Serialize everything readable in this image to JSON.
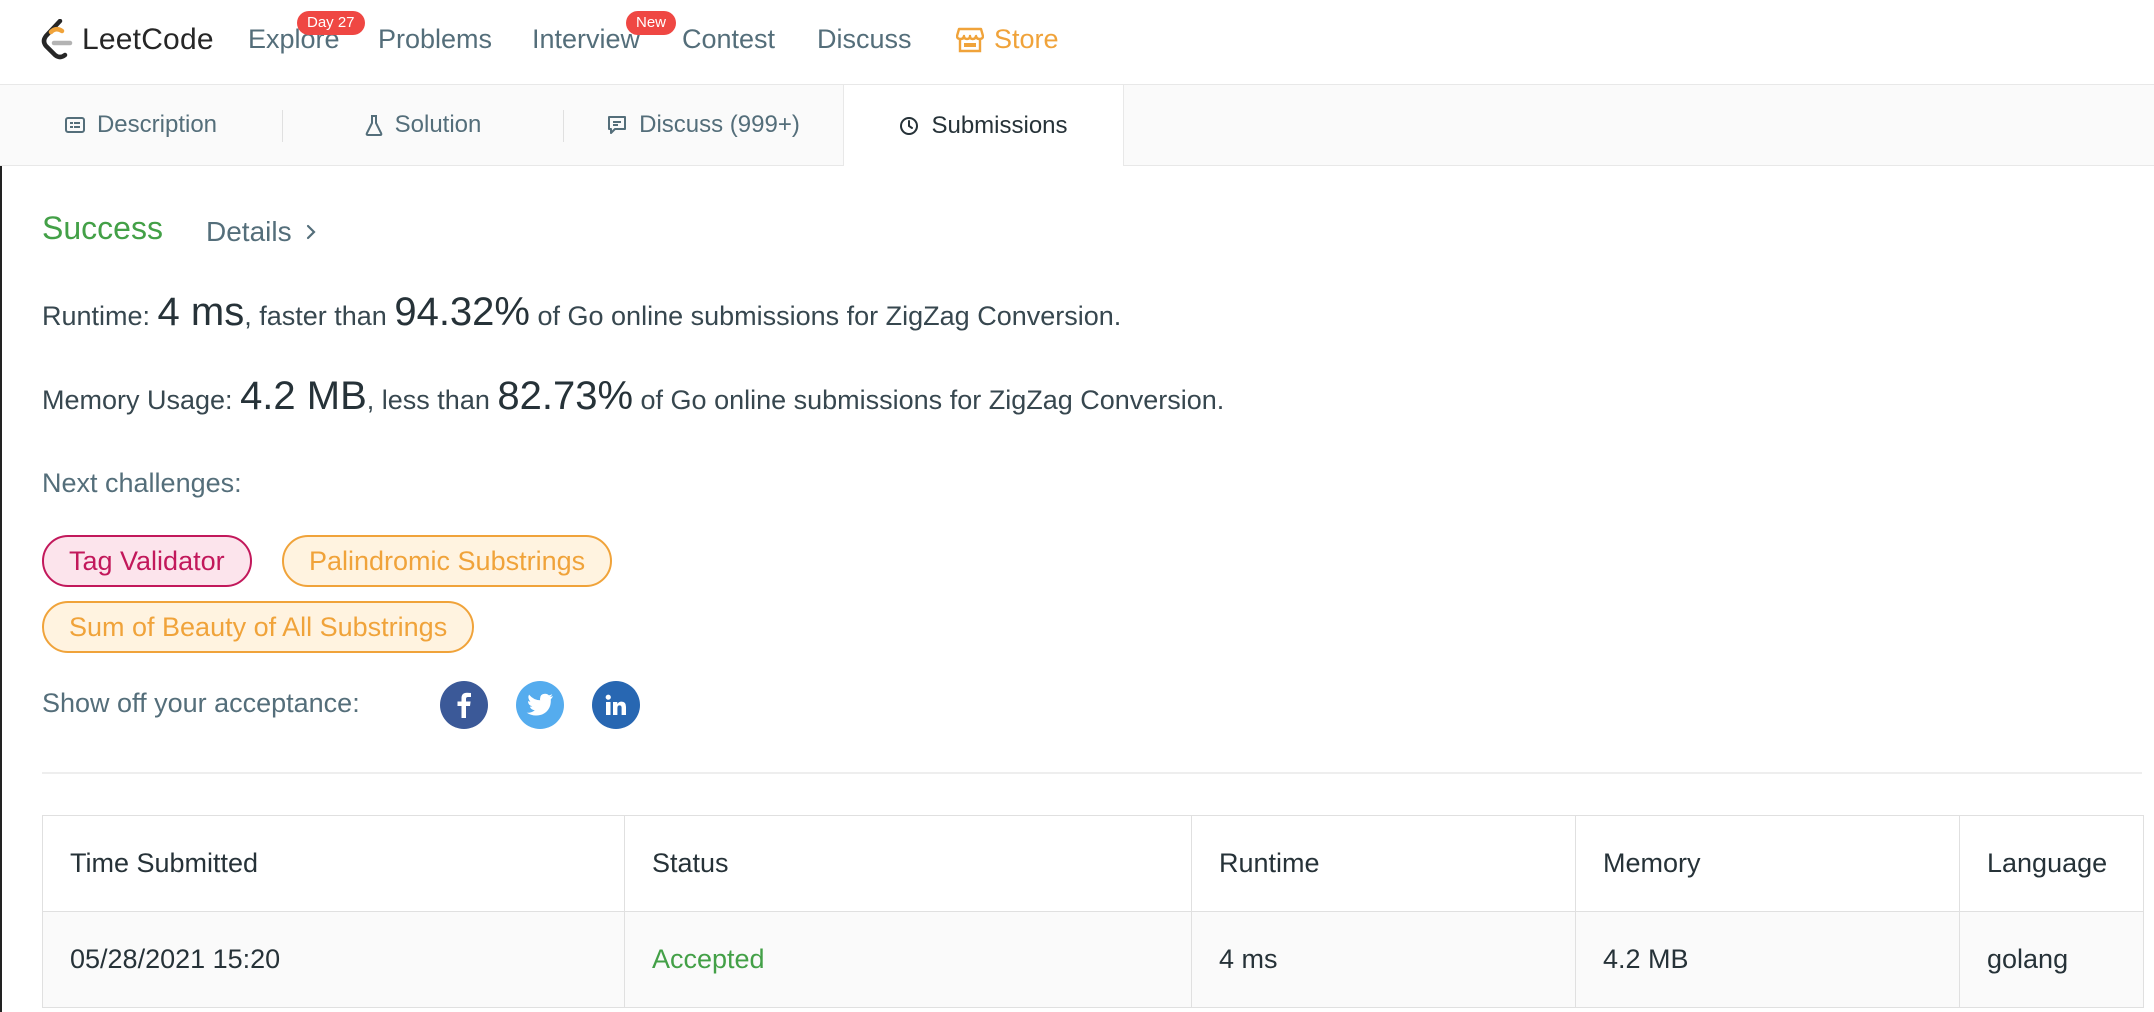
{
  "app": {
    "logo_text": "LeetCode"
  },
  "nav": {
    "items": [
      {
        "label": "Explore",
        "badge": "Day 27"
      },
      {
        "label": "Problems"
      },
      {
        "label": "Interview",
        "badge": "New"
      },
      {
        "label": "Contest"
      },
      {
        "label": "Discuss"
      },
      {
        "label": "Store",
        "icon": "store-icon"
      }
    ]
  },
  "tabs": [
    {
      "label": "Description",
      "icon": "description-icon"
    },
    {
      "label": "Solution",
      "icon": "flask-icon"
    },
    {
      "label": "Discuss (999+)",
      "icon": "comment-icon"
    },
    {
      "label": "Submissions",
      "icon": "clock-icon",
      "active": true
    }
  ],
  "result": {
    "status": "Success",
    "details_label": "Details",
    "runtime": {
      "label": "Runtime: ",
      "value": "4 ms",
      "mid": ", faster than ",
      "percent": "94.32%",
      "tail": " of Go online submissions for ZigZag Conversion."
    },
    "memory": {
      "label": "Memory Usage: ",
      "value": "4.2 MB",
      "mid": ", less than ",
      "percent": "82.73%",
      "tail": " of Go online submissions for ZigZag Conversion."
    },
    "next_label": "Next challenges:",
    "challenges": [
      {
        "label": "Tag Validator",
        "difficulty": "hard"
      },
      {
        "label": "Palindromic Substrings",
        "difficulty": "medium"
      },
      {
        "label": "Sum of Beauty of All Substrings",
        "difficulty": "medium"
      }
    ],
    "share_label": "Show off your acceptance:",
    "share": [
      {
        "icon": "facebook-icon",
        "color": "#3b5998"
      },
      {
        "icon": "twitter-icon",
        "color": "#55acee"
      },
      {
        "icon": "linkedin-icon",
        "color": "#2867b2"
      }
    ]
  },
  "table": {
    "headers": [
      "Time Submitted",
      "Status",
      "Runtime",
      "Memory",
      "Language"
    ],
    "rows": [
      [
        "05/28/2021 15:20",
        "Accepted",
        "4 ms",
        "4.2 MB",
        "golang"
      ]
    ]
  },
  "colors": {
    "success": "#43a047",
    "store": "#f0a33a",
    "badge": "#ef4743",
    "hard": "#c2185b",
    "medium": "#f0a33a"
  }
}
